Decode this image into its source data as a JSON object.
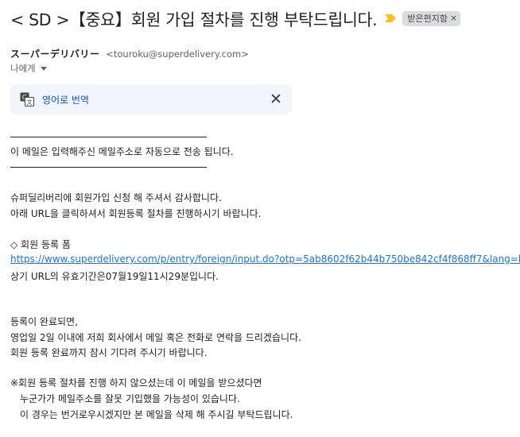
{
  "email": {
    "subject": "< SD >【중요】회원 가입 절차를 진행 부탁드립니다.",
    "label_chip": "받은편지함",
    "label_chip_close": "×",
    "sender_name": "スーパーデリバリー",
    "sender_email": "<touroku@superdelivery.com>",
    "recipient": "나에게",
    "translate_label": "영어로 번역",
    "body": {
      "notice": "이 메일은 입력해주신 메일주소로 자동으로 전송 됩니다.",
      "thanks": "슈퍼딜리버리에 회원가입 신청 해 주셔서 감사합니다.",
      "instruction": "아래 URL을 클릭하셔서 회원등록 절차를 진행하시기 바랍니다.",
      "form_heading": "◇ 회원 등록 폼",
      "form_link": "https://www.superdelivery.com/p/entry/foreign/input.do?otp=5ab8602f62b44b750be842cf4f868ff7&lang=ko",
      "validity": "상기 URL의 유효기간은07월19일11시29분입니다.",
      "after1": "등록이 완료되면,",
      "after2": "영업일 2일 이내에 저희 회사에서 메일 혹은 전화로 연락을 드리겠습니다.",
      "after3": "회원 등록 완료까지 잠시 기다려 주시기 바랍니다.",
      "note1": "※회원 등록 절차를 진행 하지 않으셨는데 이 메일을 받으셨다면",
      "note2": "　누군가가 메일주소를 잘못 기입했을 가능성이 있습니다.",
      "note3": "　이 경우는 번거로우시겠지만 본 메일을 삭제 해 주시길 부탁드립니다."
    }
  },
  "colors": {
    "link": "#1a73e8",
    "translate_bg": "#f2f6fc",
    "important_marker": "#f6c026"
  },
  "icons": {
    "important": "important-marker-icon",
    "translate": "translate-icon",
    "close": "close-icon",
    "dropdown": "chevron-down-icon"
  }
}
